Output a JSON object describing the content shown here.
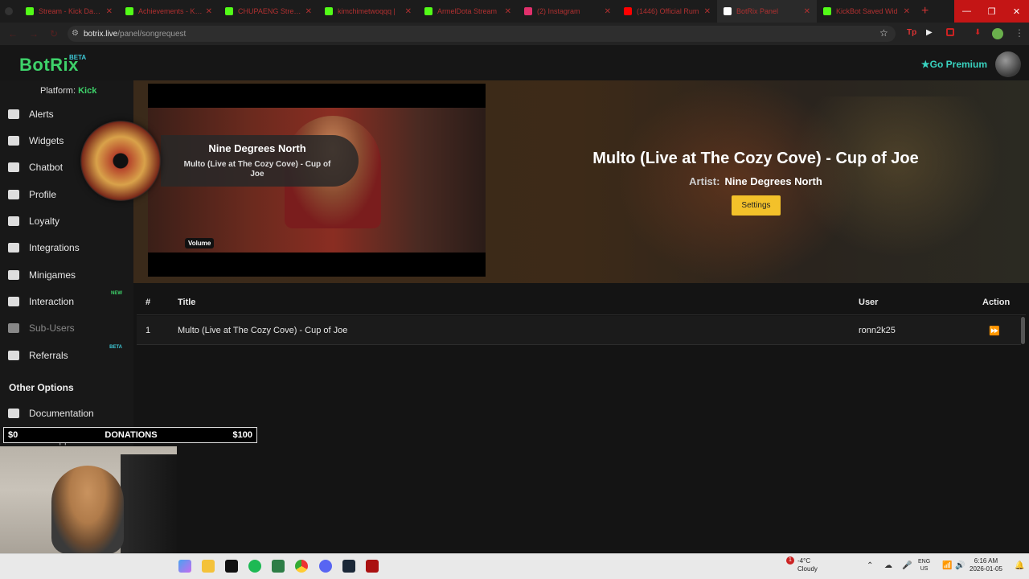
{
  "browser": {
    "tabs": [
      {
        "label": "Stream - Kick Dashb",
        "icon": "kick-icon",
        "color": "#53fc18"
      },
      {
        "label": "Achievements - Kick",
        "icon": "kick-icon",
        "color": "#53fc18"
      },
      {
        "label": "CHUPAENG Stream",
        "icon": "kick-icon",
        "color": "#53fc18"
      },
      {
        "label": "kimchimetwoqqq |",
        "icon": "kick-icon",
        "color": "#53fc18"
      },
      {
        "label": "ArmelDota Stream",
        "icon": "kick-icon",
        "color": "#53fc18"
      },
      {
        "label": "(2) Instagram",
        "icon": "instagram-icon",
        "color": "#e1306c"
      },
      {
        "label": "(1446) Official Rum",
        "icon": "youtube-icon",
        "color": "#ff0000"
      },
      {
        "label": "BotRix Panel",
        "icon": "botrix-icon",
        "color": "#ffffff"
      },
      {
        "label": "KickBot Saved Wid",
        "icon": "kickbot-icon",
        "color": "#53fc18"
      }
    ],
    "url_host": "botrix.live",
    "url_path": "/panel/songrequest"
  },
  "app": {
    "logo": "BotRix",
    "logo_badge": "BETA",
    "premium_label": "Go Premium",
    "platform_label": "Platform:",
    "platform_value": "Kick"
  },
  "sidebar": {
    "items": [
      {
        "label": "Alerts",
        "icon": "warning-icon",
        "badge": ""
      },
      {
        "label": "Widgets",
        "icon": "widgets-icon",
        "badge": ""
      },
      {
        "label": "Chatbot",
        "icon": "robot-icon",
        "badge": ""
      },
      {
        "label": "Profile",
        "icon": "profile-card-icon",
        "badge": ""
      },
      {
        "label": "Loyalty",
        "icon": "trophy-icon",
        "badge": ""
      },
      {
        "label": "Integrations",
        "icon": "integrations-icon",
        "badge": ""
      },
      {
        "label": "Minigames",
        "icon": "gamepad-icon",
        "badge": ""
      },
      {
        "label": "Interaction",
        "icon": "music-icon",
        "badge": "NEW"
      },
      {
        "label": "Sub-Users",
        "icon": "users-icon",
        "badge": ""
      },
      {
        "label": "Referrals",
        "icon": "referrals-icon",
        "badge": "BETA"
      }
    ],
    "other_heading": "Other Options",
    "other_items": [
      {
        "label": "Documentation",
        "icon": "docs-icon"
      },
      {
        "label": "Get Support",
        "icon": "support-icon"
      }
    ]
  },
  "player": {
    "artist": "Nine Degrees North",
    "title": "Multo (Live at The Cozy Cove) - Cup of Joe",
    "volume_label": "Volume",
    "now_playing_title": "Multo (Live at The Cozy Cove) - Cup of Joe",
    "artist_label": "Artist:",
    "now_playing_artist": "Nine Degrees North",
    "settings_label": "Settings"
  },
  "queue": {
    "headers": {
      "num": "#",
      "title": "Title",
      "user": "User",
      "action": "Action"
    },
    "rows": [
      {
        "num": "1",
        "title": "Multo (Live at The Cozy Cove) - Cup of Joe",
        "user": "ronn2k25"
      }
    ]
  },
  "overlay": {
    "don_left": "$0",
    "don_mid": "DONATIONS",
    "don_right": "$100"
  },
  "taskbar": {
    "weather_temp": "-4°C",
    "weather_desc": "Cloudy",
    "weather_alert": "1",
    "lang_top": "ENG",
    "lang_bottom": "US",
    "time": "6:16 AM",
    "date": "2026-01-05"
  },
  "colors": {
    "accent_green": "#3ed26a",
    "accent_teal": "#39d3c0",
    "settings_yellow": "#f3c12a",
    "tab_text_red": "#b03030"
  }
}
